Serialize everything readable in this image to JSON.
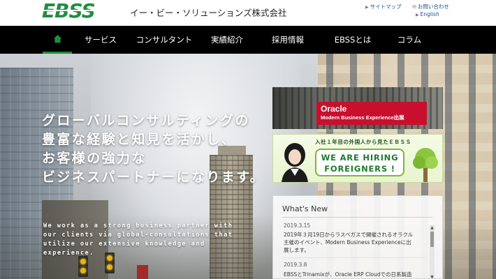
{
  "header": {
    "logo_text": "EBSS",
    "company_name": "イー・ビー・ソリューションズ株式会社",
    "links": {
      "sitemap": "サイトマップ",
      "contact": "お問い合わせ",
      "english": "English"
    }
  },
  "nav": {
    "home_icon": "home-icon",
    "items": [
      {
        "label": "サービス"
      },
      {
        "label": "コンサルタント"
      },
      {
        "label": "実績紹介"
      },
      {
        "label": "採用情報"
      },
      {
        "label": "EBSSとは"
      },
      {
        "label": "コラム"
      }
    ]
  },
  "hero": {
    "headline_lines": [
      "グローバルコンサルティングの",
      "豊富な経験と知見を活かし、",
      "お客様の強力な",
      "ビジネスパートナーになります。"
    ],
    "english_lines": [
      "We work as a strong business partner with",
      "our clients via global-consultations that",
      "utilize our extensive knowledge and",
      "experience."
    ]
  },
  "banners": {
    "oracle": {
      "title": "Oracle",
      "subtitle": "Modern Business Experience出展"
    },
    "hiring": {
      "subtitle": "入社１年目の外国人から見たＥＢＳＳ",
      "line1": "WE ARE HIRING",
      "line2": "FOREIGNERS !"
    }
  },
  "news": {
    "title": "What's New",
    "items": [
      {
        "date": "2019.3.15",
        "text_line1": "2019年３月19日からラスベガスで開催されるオラクル",
        "text_line2": "主催のイベント、Modern Business Experienceに出",
        "text_line3": "展します。"
      },
      {
        "date": "2019.3.8",
        "text_line1": "EBSSとTrinamixが、Oracle ERP Cloudでの日系製造"
      }
    ]
  },
  "colors": {
    "brand_green": "#1f8f3e",
    "nav_bg": "#000000",
    "oracle_red": "#c8102e",
    "link_blue": "#1a4fa0"
  }
}
